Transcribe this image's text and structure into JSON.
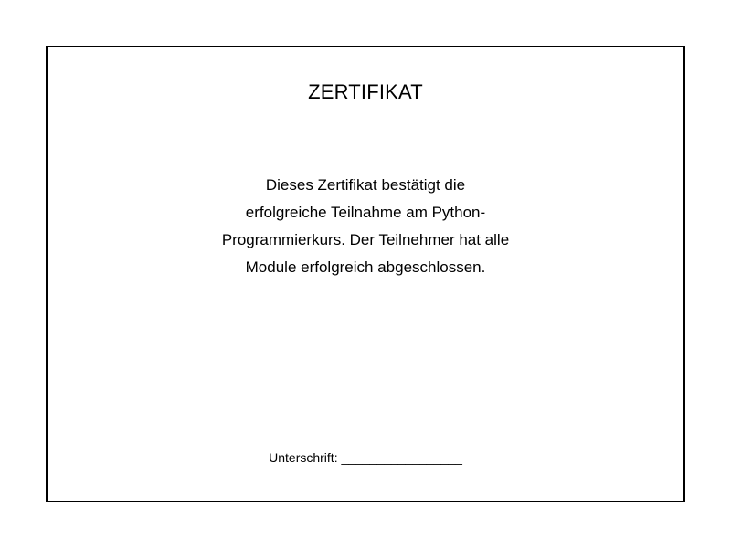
{
  "certificate": {
    "title": "ZERTIFIKAT",
    "body_lines": [
      "Dieses Zertifikat bestätigt die",
      "erfolgreiche Teilnahme am Python-",
      "Programmierkurs. Der Teilnehmer hat alle",
      "Module erfolgreich abgeschlossen."
    ],
    "signature_label": "Unterschrift:",
    "signature_line": "_________________"
  }
}
